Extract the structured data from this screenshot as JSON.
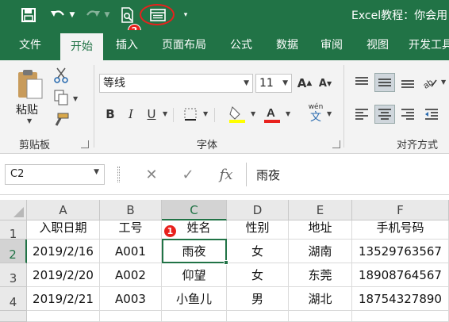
{
  "titlebar": {
    "title": "Excel教程：你会用",
    "badge_1": "1",
    "badge_2": "2"
  },
  "tabs": [
    {
      "label": "文件"
    },
    {
      "label": "开始"
    },
    {
      "label": "插入"
    },
    {
      "label": "页面布局"
    },
    {
      "label": "公式"
    },
    {
      "label": "数据"
    },
    {
      "label": "审阅"
    },
    {
      "label": "视图"
    },
    {
      "label": "开发工具"
    }
  ],
  "ribbon": {
    "clipboard": {
      "paste_label": "粘贴",
      "group_label": "剪贴板"
    },
    "font": {
      "font_name": "等线",
      "font_size": "11",
      "group_label": "字体",
      "wen_label": "wén",
      "wen_char": "文"
    },
    "alignment": {
      "group_label": "对齐方式"
    }
  },
  "formula_bar": {
    "name_box": "C2",
    "fx_label": "fx",
    "value": "雨夜"
  },
  "sheet": {
    "columns": [
      "A",
      "B",
      "C",
      "D",
      "E",
      "F"
    ],
    "rows": [
      "1",
      "2",
      "3",
      "4"
    ],
    "data": [
      [
        "入职日期",
        "工号",
        "姓名",
        "性别",
        "地址",
        "手机号码"
      ],
      [
        "2019/2/16",
        "A001",
        "雨夜",
        "女",
        "湖南",
        "13529763567"
      ],
      [
        "2019/2/20",
        "A002",
        "仰望",
        "女",
        "东莞",
        "18908764567"
      ],
      [
        "2019/2/21",
        "A003",
        "小鱼儿",
        "男",
        "湖北",
        "18754327890"
      ]
    ],
    "selected_cell": "C2"
  },
  "colors": {
    "brand": "#217346",
    "annotation": "#e8211d"
  }
}
